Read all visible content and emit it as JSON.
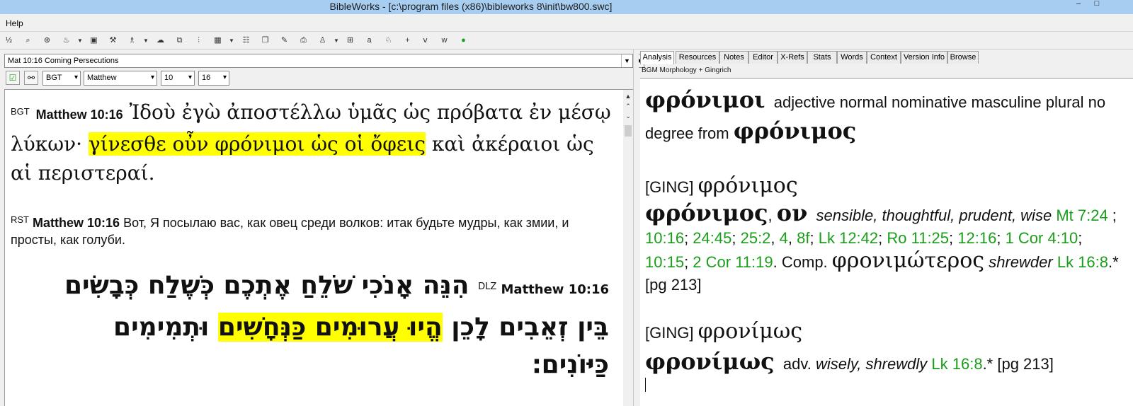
{
  "window": {
    "title": "BibleWorks - [c:\\program files (x86)\\bibleworks 8\\init\\bw800.swc]",
    "minimize": "–",
    "maximize": "□"
  },
  "menu": {
    "help": "Help"
  },
  "toolbar": {
    "icons": [
      "verse-list-icon",
      "search-icon",
      "crosshair-icon",
      "map-icon",
      "dropdown-icon",
      "text-icon",
      "tools-icon",
      "user-icon",
      "dropdown-icon",
      "highlight-icon",
      "windows-icon",
      "columns-icon",
      "grid-icon",
      "dropdown-icon",
      "list-icon",
      "copy-icon",
      "edit-icon",
      "print-icon",
      "print-setup-icon",
      "dropdown-icon",
      "layout-icon",
      "parse-icon",
      "person-icon",
      "plus-icon",
      "version-icon",
      "word-icon",
      "globe-icon"
    ]
  },
  "left": {
    "verse_selector": "Mat 10:16 Coming Persecutions",
    "version": "BGT",
    "book": "Matthew",
    "chapter": "10",
    "verse": "16",
    "verses": {
      "bgt": {
        "tag": "BGT",
        "ref": "Matthew 10:16",
        "text_a": "Ἰδοὺ ἐγὼ ἀποστέλλω ὑμᾶς ὡς πρόβατα ἐν μέσῳ λύκων· ",
        "text_hl": "γίνεσθε οὖν φρόνιμοι ὡς οἱ ὄφεις",
        "text_b": " καὶ ἀκέραιοι ὡς αἱ περιστεραί."
      },
      "rst": {
        "tag": "RST",
        "ref": "Matthew 10:16",
        "text": "Вот, Я посылаю вас, как овец среди волков: итак будьте мудры, как змии, и просты, как голуби."
      },
      "dlz": {
        "tag": "DLZ",
        "ref": "Matthew 10:16",
        "text_a": "הִנֵּה אָנֹכִי שֹׁלֵחַ אֶתְכֶם כְּשֶׁלַח כְּבָשִׂים בֵּין זְאֵבִים לָכֵן ",
        "text_hl": "הֱיוּ עֲרוּמִים כַּנְּחָשִׁים",
        "text_b": " וּתְמִימִים כַּיּוֹנִים׃"
      }
    }
  },
  "right": {
    "tabs": [
      "Analysis",
      "Resources",
      "Notes",
      "Editor",
      "X-Refs",
      "Stats",
      "Words",
      "Context",
      "Version Info",
      "Browse"
    ],
    "active_tab": "Analysis",
    "lexicon_label": "BGM Morphology + Gingrich",
    "morph": {
      "word": "φρόνιμοι",
      "desc": "adjective normal nominative masculine plural no degree from",
      "lemma": "φρόνιμος"
    },
    "entry1": {
      "tag": "[GING]",
      "head": "φρόνιμος",
      "lemma": "φρόνιμος",
      "ending": "ον",
      "gloss": "sensible, thoughtful, prudent, wise",
      "refs1": [
        "Mt 7:24"
      ],
      "refs2": [
        "10:16",
        "24:45",
        "25:2",
        "4",
        "8f",
        "Lk 12:42",
        "Ro 11:25",
        "12:16"
      ],
      "refs3": [
        "1 Cor 4:10",
        "10:15",
        "2 Cor 11:19"
      ],
      "comp_label": "Comp.",
      "comp_word": "φρονιμώτερος",
      "comp_gloss": "shrewder",
      "comp_ref": "Lk 16:8",
      "page": ".* [pg 213]"
    },
    "entry2": {
      "tag": "[GING]",
      "head": "φρονίμως",
      "lemma": "φρονίμως",
      "pos": "adv.",
      "gloss": "wisely, shrewdly",
      "ref": "Lk 16:8",
      "page": ".* [pg 213]"
    }
  }
}
